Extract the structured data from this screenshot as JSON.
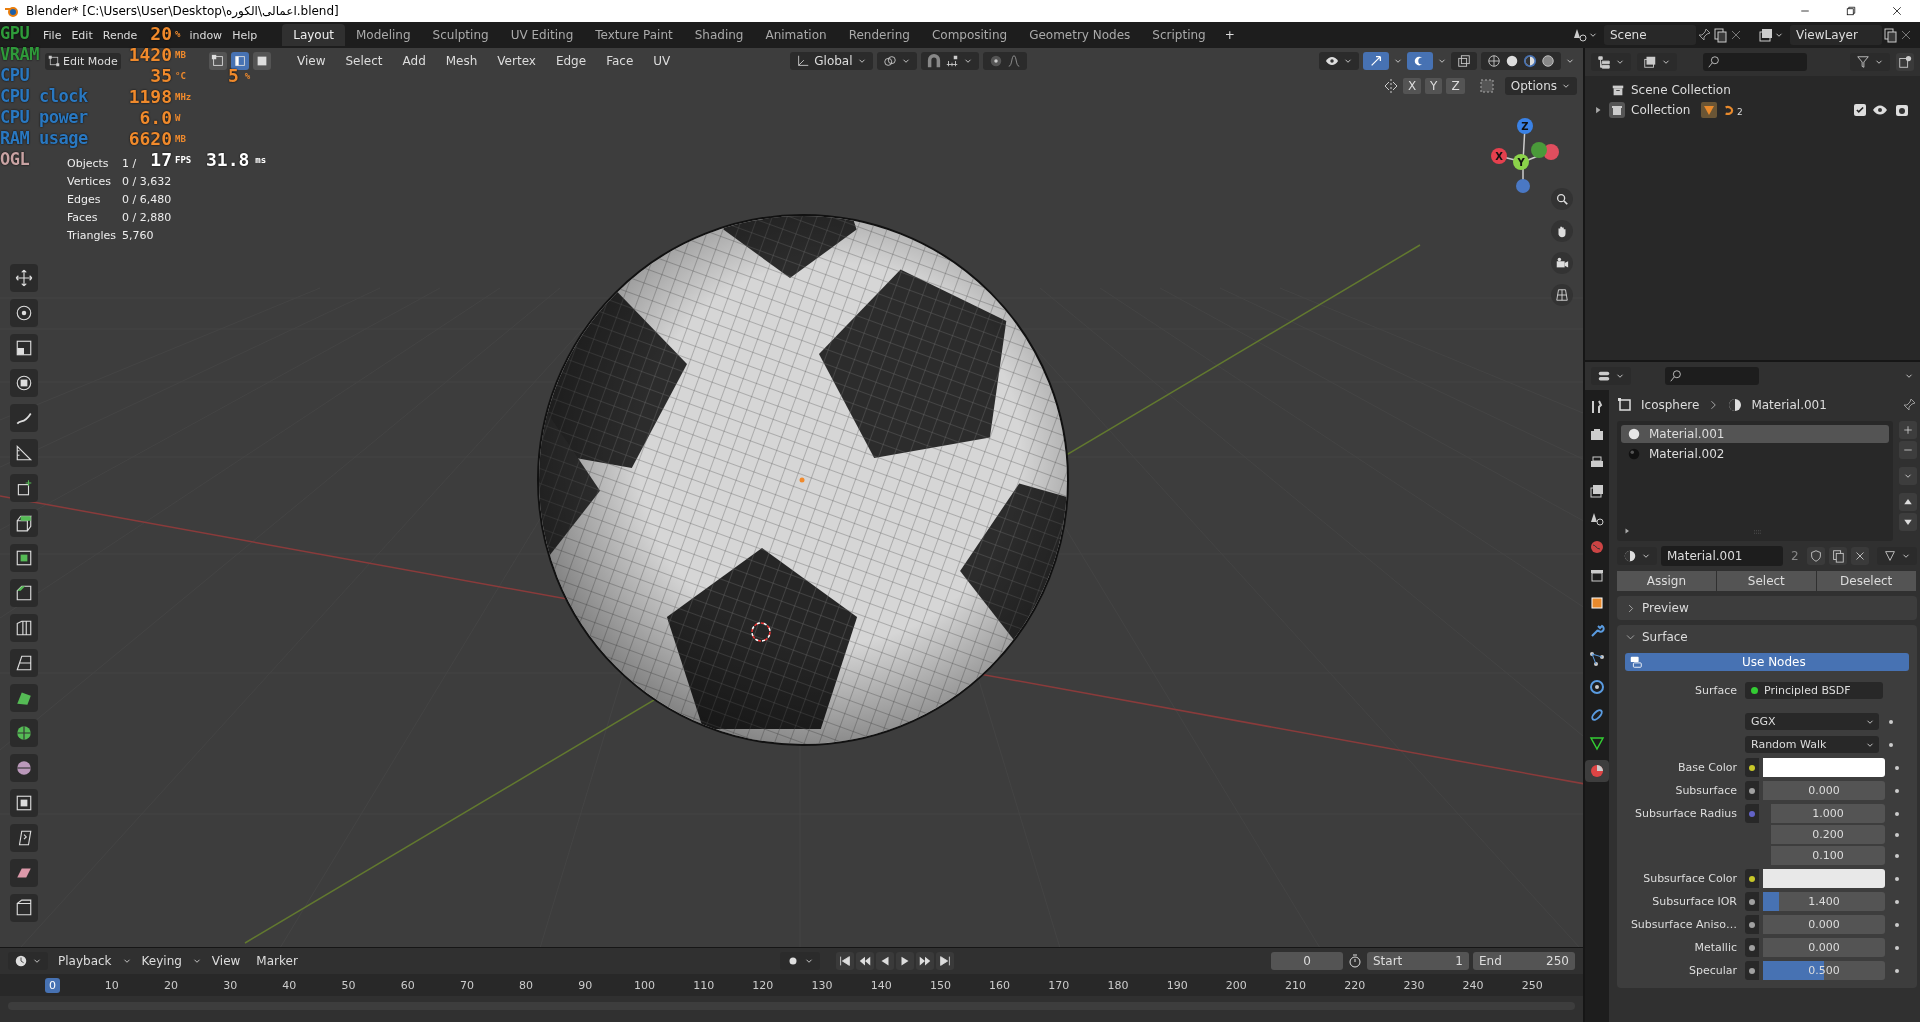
{
  "title_bar": {
    "title": "Blender* [C:\\Users\\User\\Desktop\\اعمالى\\الكوره.blend]"
  },
  "menu": [
    "File",
    "Edit",
    "Rende",
    "indow",
    "Help"
  ],
  "workspaces": [
    {
      "label": "Layout",
      "selected": true
    },
    {
      "label": "Modeling",
      "selected": false
    },
    {
      "label": "Sculpting",
      "selected": false
    },
    {
      "label": "UV Editing",
      "selected": false
    },
    {
      "label": "Texture Paint",
      "selected": false
    },
    {
      "label": "Shading",
      "selected": false
    },
    {
      "label": "Animation",
      "selected": false
    },
    {
      "label": "Rendering",
      "selected": false
    },
    {
      "label": "Compositing",
      "selected": false
    },
    {
      "label": "Geometry Nodes",
      "selected": false
    },
    {
      "label": "Scripting",
      "selected": false
    }
  ],
  "add_workspace": "+",
  "scene": {
    "name": "Scene"
  },
  "view_layer": {
    "name": "ViewLayer"
  },
  "overlay_monitor": {
    "rows": [
      {
        "kind": "hardware",
        "label": "GPU",
        "color": "#2f9a3a",
        "value": "20",
        "unit": "%"
      },
      {
        "kind": "hardware",
        "label": "VRAM",
        "color": "#2f9a3a",
        "value": "1420",
        "unit": "MB"
      },
      {
        "kind": "hardware",
        "label": "CPU",
        "color": "#2a78c0",
        "value": "35",
        "unit": "°C",
        "extra_value": "5",
        "extra_unit": "%"
      },
      {
        "kind": "hardware",
        "label": "CPU clock",
        "color": "#2a78c0",
        "value": "1198",
        "unit": "MHz"
      },
      {
        "kind": "hardware",
        "label": "CPU power",
        "color": "#2a78c0",
        "value": "6.0",
        "unit": "W"
      },
      {
        "kind": "hardware",
        "label": "RAM usage",
        "color": "#2a78c0",
        "value": "6620",
        "unit": "MB"
      },
      {
        "kind": "framerate",
        "label": "OGL",
        "color": "#c9a3a3",
        "value": "17",
        "unit": "FPS",
        "extra_value": "31.8",
        "extra_unit": "ms"
      }
    ]
  },
  "viewport": {
    "mode": "Edit Mode",
    "select_modes": [
      {
        "selected": false
      },
      {
        "selected": true
      },
      {
        "selected": false
      }
    ],
    "menus": [
      "View",
      "Select",
      "Add",
      "Mesh",
      "Vertex",
      "Edge",
      "Face",
      "UV"
    ],
    "orientation": "Global",
    "mirror_axes": [
      "X",
      "Y",
      "Z"
    ],
    "options": "Options",
    "stats": [
      {
        "label": "Objects",
        "value": "1 /"
      },
      {
        "label": "Vertices",
        "value": "0 / 3,632"
      },
      {
        "label": "Edges",
        "value": "0 / 6,480"
      },
      {
        "label": "Faces",
        "value": "0 / 2,880"
      },
      {
        "label": "Triangles",
        "value": "5,760"
      }
    ],
    "gizmo_axes": [
      "Z",
      "Y",
      "X"
    ]
  },
  "timeline": {
    "menus": [
      "Playback",
      "Keying",
      "View",
      "Marker"
    ],
    "current_frame": "0",
    "start_label": "Start",
    "start": "1",
    "end_label": "End",
    "end": "250",
    "ruler": [
      {
        "label": "0",
        "selected": true
      },
      {
        "label": "10",
        "selected": false
      },
      {
        "label": "20",
        "selected": false
      },
      {
        "label": "30",
        "selected": false
      },
      {
        "label": "40",
        "selected": false
      },
      {
        "label": "50",
        "selected": false
      },
      {
        "label": "60",
        "selected": false
      },
      {
        "label": "70",
        "selected": false
      },
      {
        "label": "80",
        "selected": false
      },
      {
        "label": "90",
        "selected": false
      },
      {
        "label": "100",
        "selected": false
      },
      {
        "label": "110",
        "selected": false
      },
      {
        "label": "120",
        "selected": false
      },
      {
        "label": "130",
        "selected": false
      },
      {
        "label": "140",
        "selected": false
      },
      {
        "label": "150",
        "selected": false
      },
      {
        "label": "160",
        "selected": false
      },
      {
        "label": "170",
        "selected": false
      },
      {
        "label": "180",
        "selected": false
      },
      {
        "label": "190",
        "selected": false
      },
      {
        "label": "200",
        "selected": false
      },
      {
        "label": "210",
        "selected": false
      },
      {
        "label": "220",
        "selected": false
      },
      {
        "label": "230",
        "selected": false
      },
      {
        "label": "240",
        "selected": false
      },
      {
        "label": "250",
        "selected": false
      }
    ]
  },
  "outliner": {
    "scene_collection": "Scene Collection",
    "collections": [
      {
        "label": "Collection",
        "expanded": false,
        "checked": true,
        "count": "2"
      }
    ]
  },
  "properties": {
    "tabs": [
      {
        "kind": "tool",
        "selected": false
      },
      {
        "kind": "render",
        "selected": false
      },
      {
        "kind": "output",
        "selected": false
      },
      {
        "kind": "view-layer",
        "selected": false
      },
      {
        "kind": "scene",
        "selected": false
      },
      {
        "kind": "world",
        "selected": false
      },
      {
        "kind": "collection",
        "selected": false
      },
      {
        "kind": "object",
        "selected": false
      },
      {
        "kind": "modifier",
        "selected": false
      },
      {
        "kind": "particles",
        "selected": false
      },
      {
        "kind": "physics",
        "selected": false
      },
      {
        "kind": "constraint",
        "selected": false
      },
      {
        "kind": "data",
        "selected": false
      },
      {
        "kind": "material",
        "selected": true
      }
    ],
    "breadcrumb": [
      "Icosphere",
      "Material.001"
    ],
    "slots": [
      {
        "label": "Material.001",
        "selected": true
      },
      {
        "label": "Material.002",
        "selected": false
      }
    ],
    "material": {
      "name": "Material.001",
      "users": "2"
    },
    "buttons": [
      "Assign",
      "Select",
      "Deselect"
    ],
    "panels": [
      {
        "title": "Preview",
        "expanded": false
      },
      {
        "title": "Surface",
        "expanded": true
      }
    ],
    "use_nodes": "Use Nodes",
    "surface_label": "Surface",
    "surface_shader": "Principled BSDF",
    "fields": [
      {
        "kind": "dropdown",
        "value": "GGX"
      },
      {
        "kind": "dropdown",
        "value": "Random Walk"
      },
      {
        "kind": "color",
        "label": "Base Color",
        "color": "#ffffff"
      },
      {
        "kind": "number",
        "label": "Subsurface",
        "value": "0.000"
      },
      {
        "kind": "vector",
        "label": "Subsurface Radius",
        "values": [
          "1.000",
          "0.200",
          "0.100"
        ]
      },
      {
        "kind": "color",
        "label": "Subsurface Color",
        "color": "#e8e8e8"
      },
      {
        "kind": "number",
        "label": "Subsurface IOR",
        "value": "1.400",
        "level": 0.13
      },
      {
        "kind": "number",
        "label": "Subsurface Aniso…",
        "value": "0.000"
      },
      {
        "kind": "number",
        "label": "Metallic",
        "value": "0.000"
      },
      {
        "kind": "number",
        "label": "Specular",
        "value": "0.500",
        "level": 0.5
      }
    ]
  }
}
